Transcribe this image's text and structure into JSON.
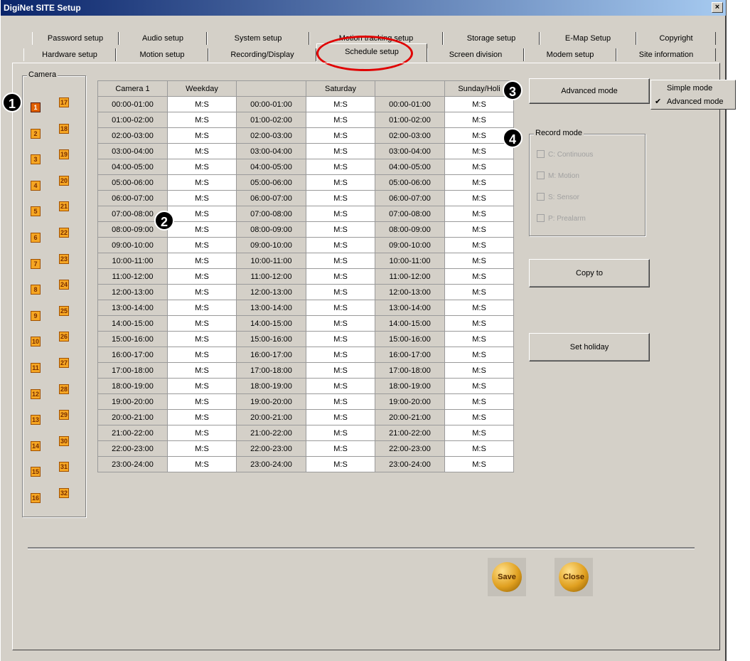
{
  "window": {
    "title": "DigiNet SITE Setup",
    "close_glyph": "×"
  },
  "tabs_row1": [
    "Password setup",
    "Audio setup",
    "System setup",
    "Motion tracking setup",
    "Storage setup",
    "E-Map Setup",
    "Copyright"
  ],
  "tabs_row2": [
    "Hardware setup",
    "Motion setup",
    "Recording/Display",
    "Schedule setup",
    "Screen division",
    "Modem setup",
    "Site information"
  ],
  "active_tab": "Schedule setup",
  "camera_group": {
    "label": "Camera",
    "left": [
      "1",
      "2",
      "3",
      "4",
      "5",
      "6",
      "7",
      "8",
      "9",
      "10",
      "11",
      "12",
      "13",
      "14",
      "15",
      "16"
    ],
    "right": [
      "17",
      "18",
      "19",
      "20",
      "21",
      "22",
      "23",
      "24",
      "25",
      "26",
      "27",
      "28",
      "29",
      "30",
      "31",
      "32"
    ],
    "selected": "1"
  },
  "schedule": {
    "headers": [
      "Camera 1",
      "Weekday",
      "",
      "Saturday",
      "",
      "Sunday/Holi"
    ],
    "times": [
      "00:00-01:00",
      "01:00-02:00",
      "02:00-03:00",
      "03:00-04:00",
      "04:00-05:00",
      "05:00-06:00",
      "06:00-07:00",
      "07:00-08:00",
      "08:00-09:00",
      "09:00-10:00",
      "10:00-11:00",
      "11:00-12:00",
      "12:00-13:00",
      "13:00-14:00",
      "14:00-15:00",
      "15:00-16:00",
      "16:00-17:00",
      "17:00-18:00",
      "18:00-19:00",
      "19:00-20:00",
      "20:00-21:00",
      "21:00-22:00",
      "22:00-23:00",
      "23:00-24:00"
    ],
    "cell_value": "M:S"
  },
  "advanced_button": "Advanced mode",
  "mode_menu": {
    "items": [
      "Simple mode",
      "Advanced mode"
    ],
    "checked": "Advanced mode",
    "check_glyph": "✔"
  },
  "record_mode": {
    "label": "Record mode",
    "options": [
      "C: Continuous",
      "M: Motion",
      "S: Sensor",
      "P: Prealarm"
    ]
  },
  "copy_button": "Copy to",
  "holiday_button": "Set holiday",
  "save_button": "Save",
  "close_button": "Close",
  "badges": [
    "1",
    "2",
    "3",
    "4"
  ]
}
